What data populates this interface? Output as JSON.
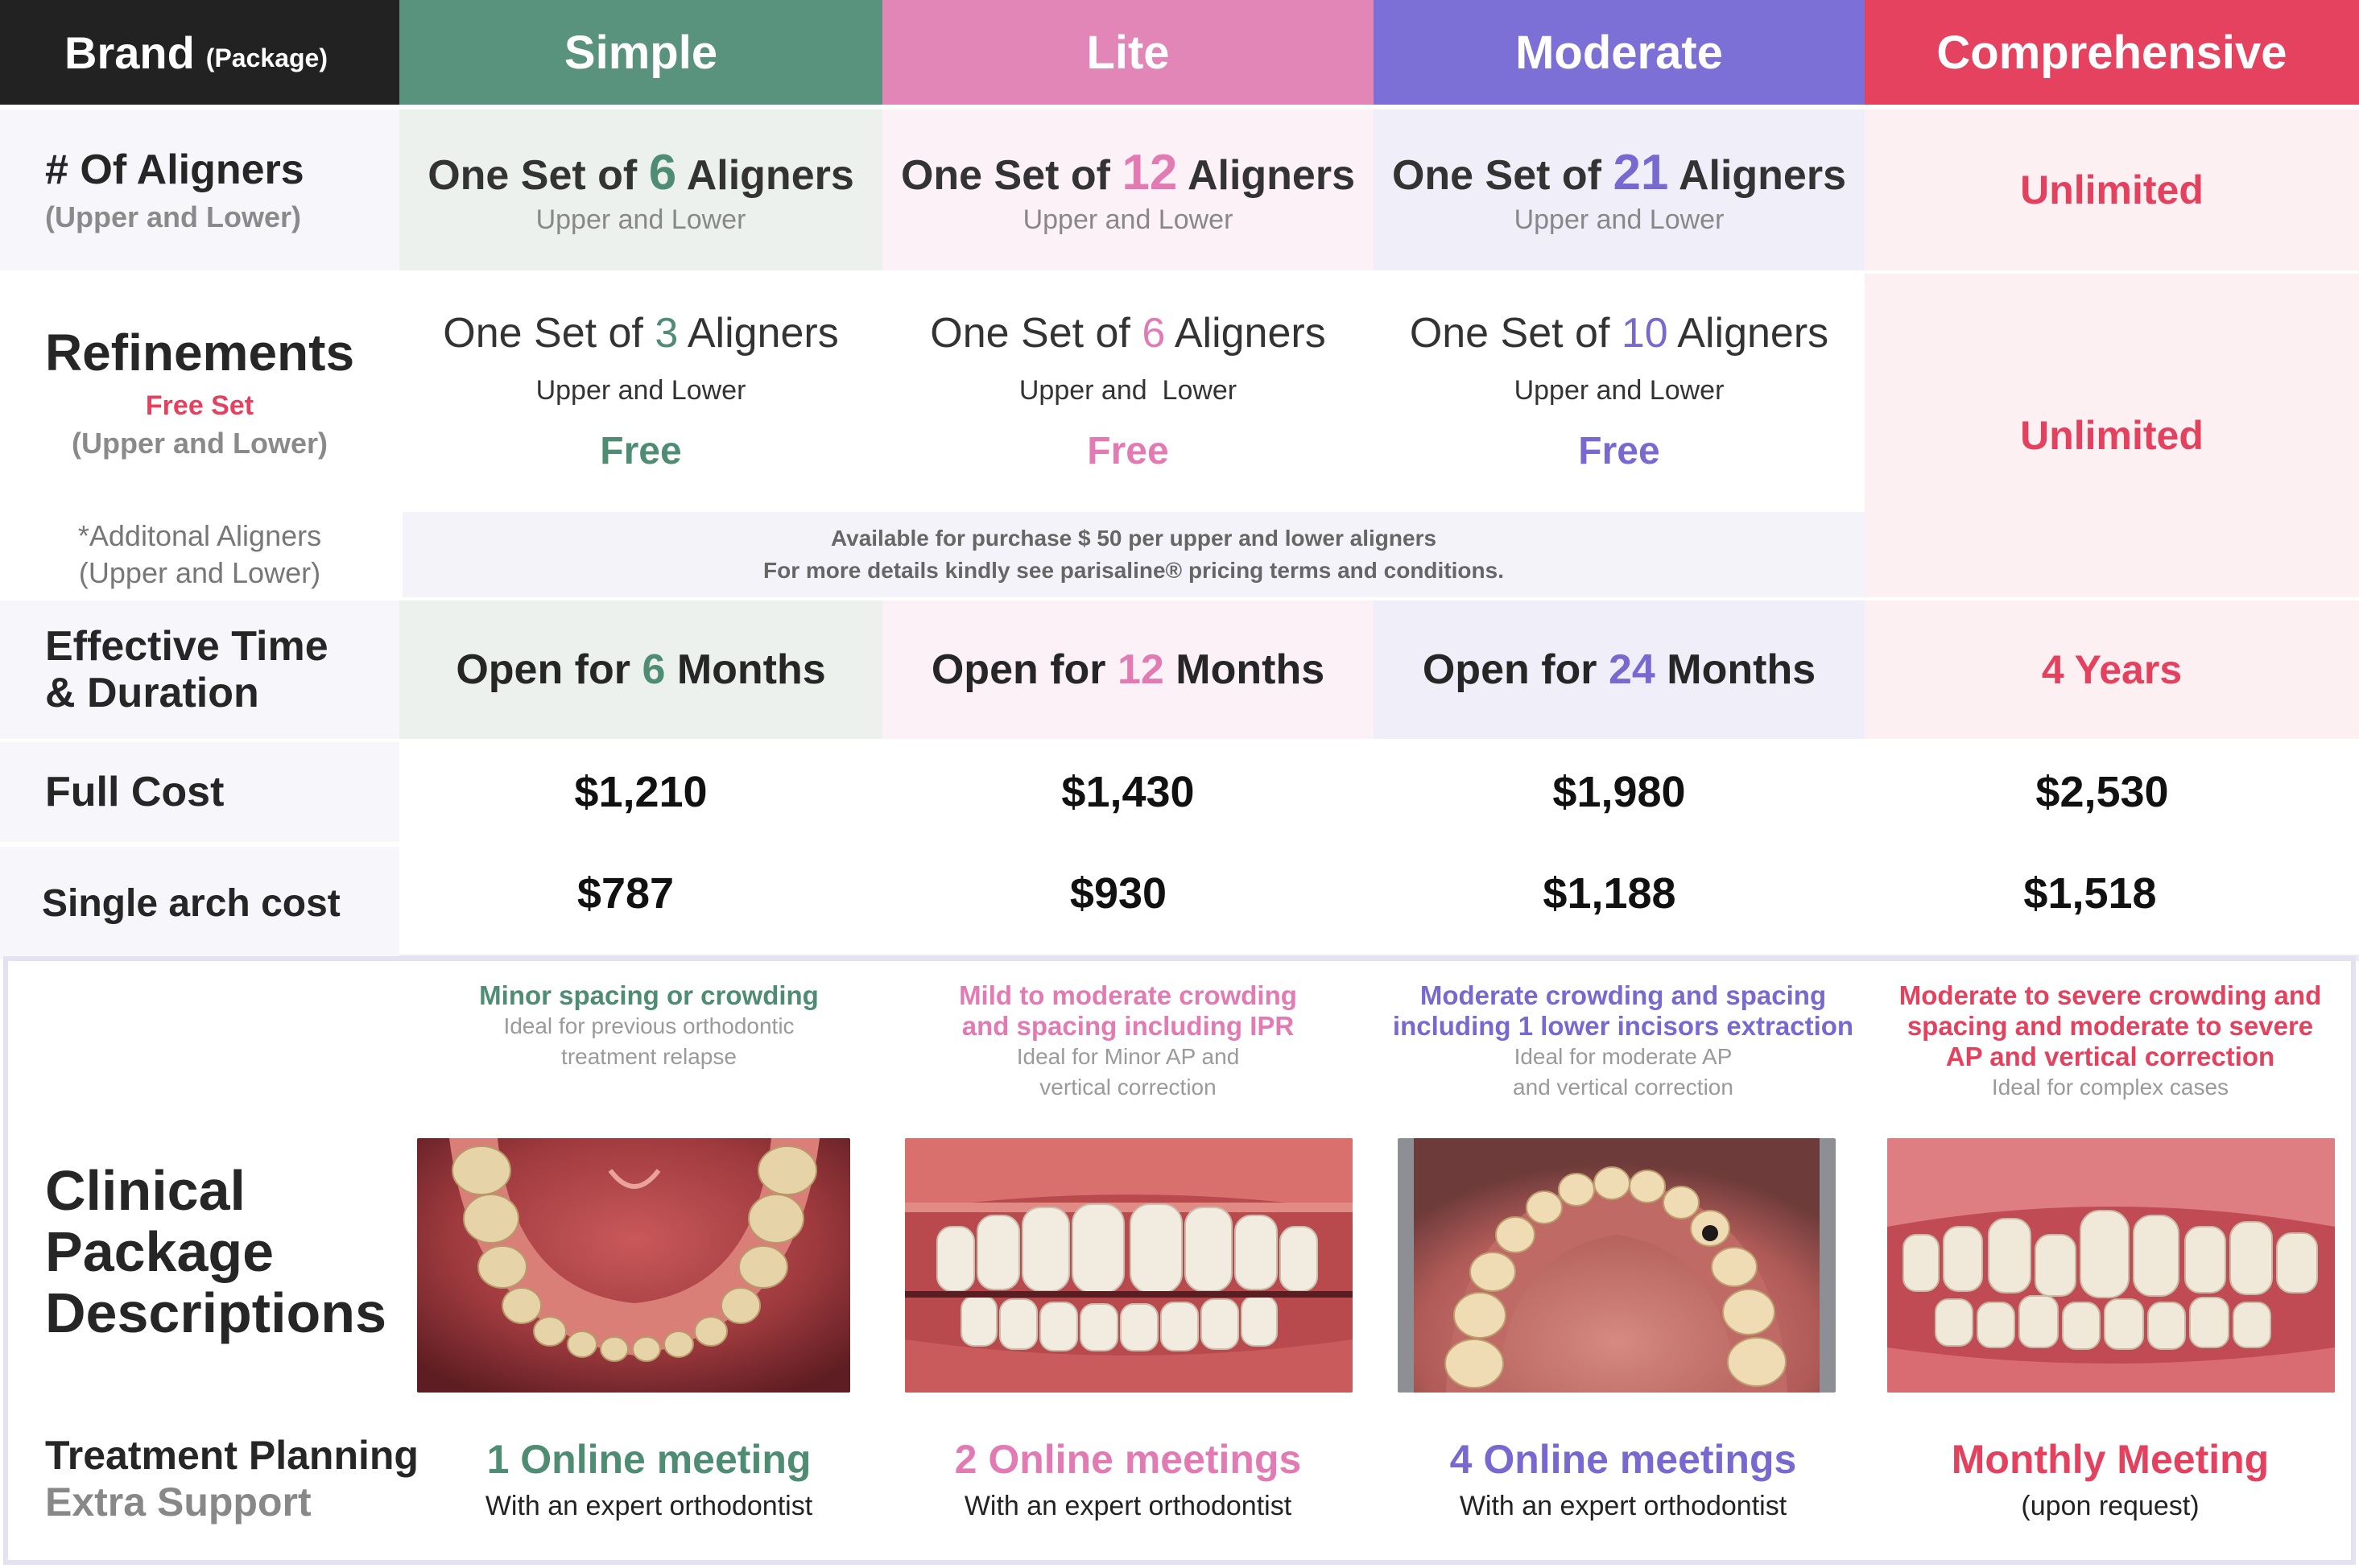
{
  "colors": {
    "simple": "#4e8c73",
    "lite": "#e27bb3",
    "moderate": "#7869d1",
    "comprehensive": "#e4415f",
    "brand_bg": "#222222"
  },
  "header": {
    "brand_label": "Brand",
    "brand_sub": "(Package)",
    "simple": "Simple",
    "lite": "Lite",
    "moderate": "Moderate",
    "comprehensive": "Comprehensive"
  },
  "aligners": {
    "label": "# Of Aligners",
    "label_sub": "(Upper and Lower)",
    "prefix": "One Set of",
    "suffix": "Aligners",
    "sub": "Upper and Lower",
    "simple_num": "6",
    "lite_num": "12",
    "moderate_num": "21",
    "comprehensive": "Unlimited"
  },
  "refinements": {
    "label": "Refinements",
    "free_set": "Free Set",
    "label_sub": "(Upper and Lower)",
    "prefix": "One Set of",
    "suffix": "Aligners",
    "sub_simple": "Upper and Lower",
    "sub_lite": "Upper and  Lower",
    "sub_moderate": "Upper and Lower",
    "simple_num": "3",
    "lite_num": "6",
    "moderate_num": "10",
    "free": "Free",
    "comprehensive": "Unlimited"
  },
  "additional": {
    "label": "*Additonal Aligners",
    "label_sub": "(Upper and Lower)",
    "line1": "Available for purchase  $ 50 per upper and lower aligners",
    "line2": "For more details kindly see parisaline® pricing terms and conditions."
  },
  "effective": {
    "label_line1": "Effective Time",
    "label_line2": "& Duration",
    "prefix": "Open for",
    "suffix": "Months",
    "simple_num": "6",
    "lite_num": "12",
    "moderate_num": "24",
    "comprehensive": "4 Years"
  },
  "full_cost": {
    "label": "Full Cost",
    "simple": "$1,210",
    "lite": "$1,430",
    "moderate": "$1,980",
    "comprehensive": "$2,530"
  },
  "single_arch": {
    "label": "Single arch cost",
    "simple": "$787",
    "lite": "$930",
    "moderate": "$1,188",
    "comprehensive": "$1,518"
  },
  "clinical": {
    "label_line1": "Clinical",
    "label_line2": "Package",
    "label_line3": "Descriptions",
    "simple_title": "Minor spacing or crowding",
    "simple_sub1": "Ideal for previous orthodontic",
    "simple_sub2": "treatment relapse",
    "lite_title1": "Mild to moderate crowding",
    "lite_title2": "and spacing including IPR",
    "lite_sub1": "Ideal for Minor AP and",
    "lite_sub2": "vertical correction",
    "moderate_title1": "Moderate crowding and spacing",
    "moderate_title2": "including 1 lower incisors extraction",
    "moderate_sub1": "Ideal for moderate AP",
    "moderate_sub2": "and vertical correction",
    "comp_title1": "Moderate to severe crowding and",
    "comp_title2": "spacing and moderate to severe",
    "comp_title3": "AP and vertical correction",
    "comp_sub": "Ideal for complex cases"
  },
  "support": {
    "label_line1": "Treatment Planning",
    "label_line2": "Extra Support",
    "simple": "1 Online meeting",
    "lite": "2 Online meetings",
    "moderate": "4 Online meetings",
    "comprehensive": "Monthly Meeting",
    "expert": "With an expert orthodontist",
    "upon_request": "(upon request)"
  }
}
